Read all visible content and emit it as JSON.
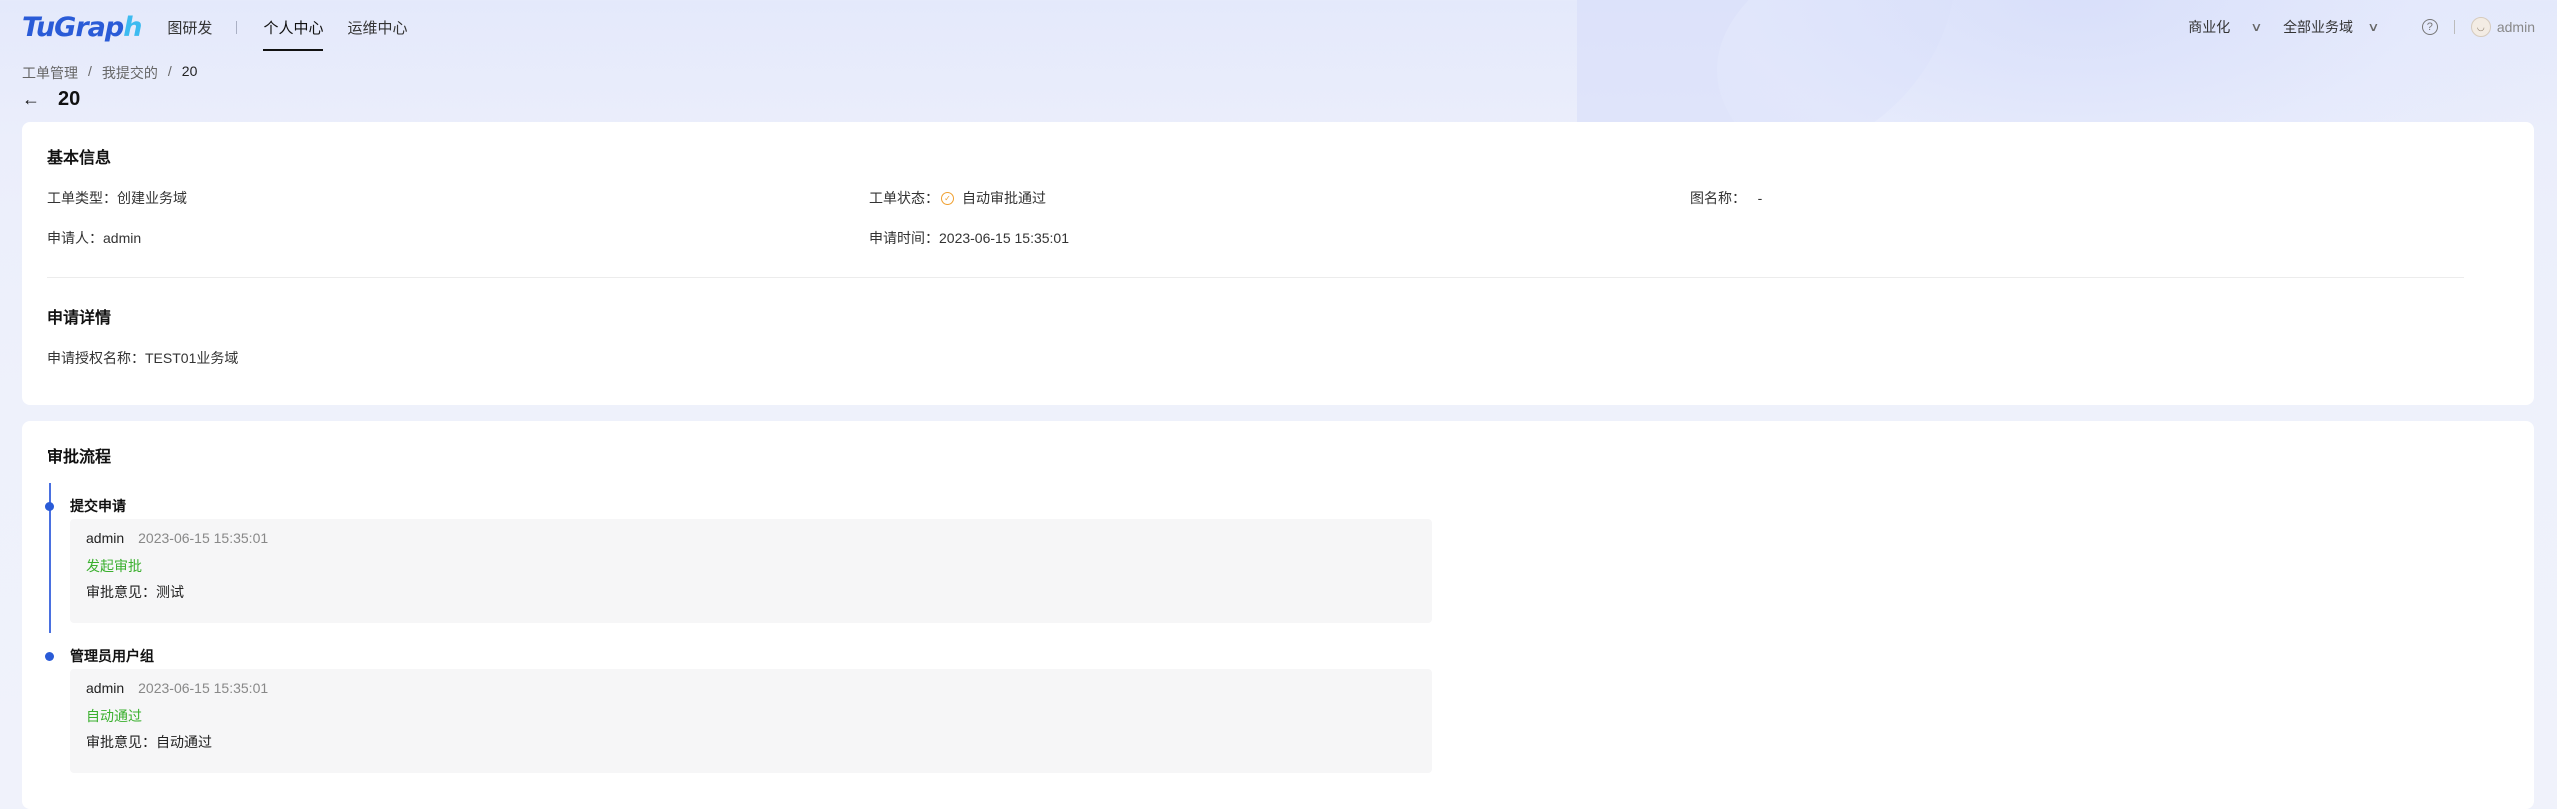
{
  "header": {
    "logo_main": "TuGrap",
    "logo_tail": "h",
    "nav": [
      "图研发",
      "个人中心",
      "运维中心"
    ],
    "commercial": "商业化",
    "domain_select": "全部业务域",
    "help_icon": "?",
    "user": "admin"
  },
  "breadcrumb": [
    "工单管理",
    "/",
    "我提交的",
    "/",
    "20"
  ],
  "page": {
    "back_icon": "←",
    "title": "20"
  },
  "basic": {
    "title": "基本信息",
    "type": "工单类型：创建业务域",
    "status_label": "工单状态：",
    "status_icon": "✓",
    "status_value": "自动审批通过",
    "graph_name": "图名称：   -",
    "applicant": "申请人：admin",
    "apply_time": "申请时间：2023-06-15 15:35:01"
  },
  "detail": {
    "title": "申请详情",
    "auth_name": "申请授权名称：TEST01业务域"
  },
  "flow": {
    "title": "审批流程",
    "steps": [
      {
        "title": "提交申请",
        "user": "admin",
        "time": "2023-06-15 15:35:01",
        "action": "发起审批",
        "comment": "审批意见：测试"
      },
      {
        "title": "管理员用户组",
        "user": "admin",
        "time": "2023-06-15 15:35:01",
        "action": "自动通过",
        "comment": "审批意见：自动通过"
      }
    ]
  }
}
